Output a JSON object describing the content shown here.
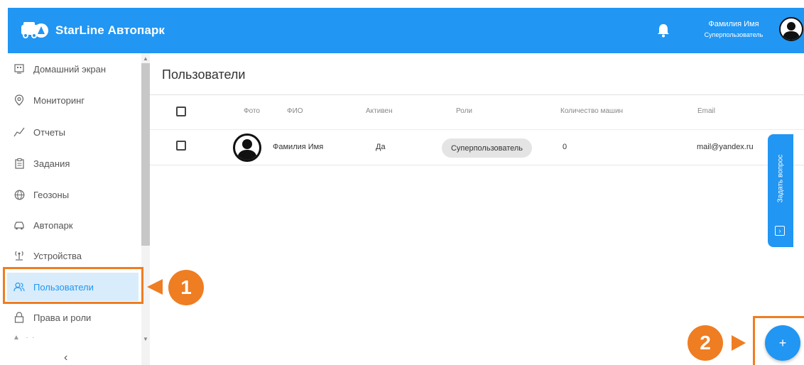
{
  "app": {
    "title": "StarLine Автопарк"
  },
  "header": {
    "user_name": "Фамилия Имя",
    "user_role": "Суперпользователь"
  },
  "sidebar": {
    "items": [
      {
        "label": "Домашний экран",
        "icon": "home-screen-icon"
      },
      {
        "label": "Мониторинг",
        "icon": "location-pin-icon"
      },
      {
        "label": "Отчеты",
        "icon": "chart-line-icon"
      },
      {
        "label": "Задания",
        "icon": "clipboard-icon"
      },
      {
        "label": "Геозоны",
        "icon": "globe-icon"
      },
      {
        "label": "Автопарк",
        "icon": "car-icon"
      },
      {
        "label": "Устройства",
        "icon": "antenna-icon"
      },
      {
        "label": "Пользователи",
        "icon": "users-icon",
        "active": true
      },
      {
        "label": "Права и роли",
        "icon": "lock-icon"
      }
    ],
    "collapse_glyph": "‹"
  },
  "main": {
    "title": "Пользователи",
    "table": {
      "columns": [
        "Фото",
        "ФИО",
        "Активен",
        "Роли",
        "Количество машин",
        "Email"
      ],
      "rows": [
        {
          "name": "Фамилия Имя",
          "active": "Да",
          "role": "Суперпользователь",
          "cars": "0",
          "email": "mail@yandex.ru"
        }
      ]
    }
  },
  "feedback": {
    "label": "Задать вопрос"
  },
  "fab": {
    "glyph": "+"
  },
  "callouts": {
    "one": "1",
    "two": "2"
  },
  "colors": {
    "primary": "#2196f3",
    "callout": "#ef7d22",
    "active_bg": "#d8ecfb"
  }
}
